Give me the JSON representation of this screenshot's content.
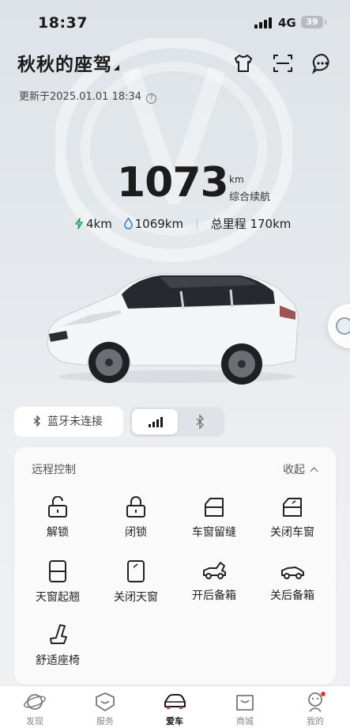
{
  "status_bar": {
    "time": "18:37",
    "network": "4G",
    "battery": "39"
  },
  "header": {
    "title": "秋秋的座驾",
    "updated": "更新于2025.01.01 18:34"
  },
  "range": {
    "value": "1073",
    "unit": "km",
    "label": "综合续航"
  },
  "stats": {
    "electric": "4km",
    "fuel": "1069km",
    "odometer": "总里程 170km"
  },
  "connection": {
    "bluetooth_status": "蓝牙未连接"
  },
  "remote": {
    "title": "远程控制",
    "collapse": "收起",
    "controls": [
      {
        "label": "解锁",
        "icon": "unlock-icon"
      },
      {
        "label": "闭锁",
        "icon": "lock-icon"
      },
      {
        "label": "车窗留缝",
        "icon": "window-vent-icon"
      },
      {
        "label": "关闭车窗",
        "icon": "window-close-icon"
      },
      {
        "label": "天窗起翘",
        "icon": "sunroof-tilt-icon"
      },
      {
        "label": "关闭天窗",
        "icon": "sunroof-close-icon"
      },
      {
        "label": "开后备箱",
        "icon": "trunk-open-icon"
      },
      {
        "label": "关后备箱",
        "icon": "trunk-close-icon"
      },
      {
        "label": "舒适座椅",
        "icon": "seat-icon"
      }
    ]
  },
  "tabs": [
    {
      "label": "发现",
      "icon": "planet-icon",
      "active": false
    },
    {
      "label": "服务",
      "icon": "service-icon",
      "active": false
    },
    {
      "label": "爱车",
      "icon": "car-icon",
      "active": true
    },
    {
      "label": "商城",
      "icon": "shop-icon",
      "active": false
    },
    {
      "label": "我的",
      "icon": "profile-icon",
      "active": false
    }
  ]
}
